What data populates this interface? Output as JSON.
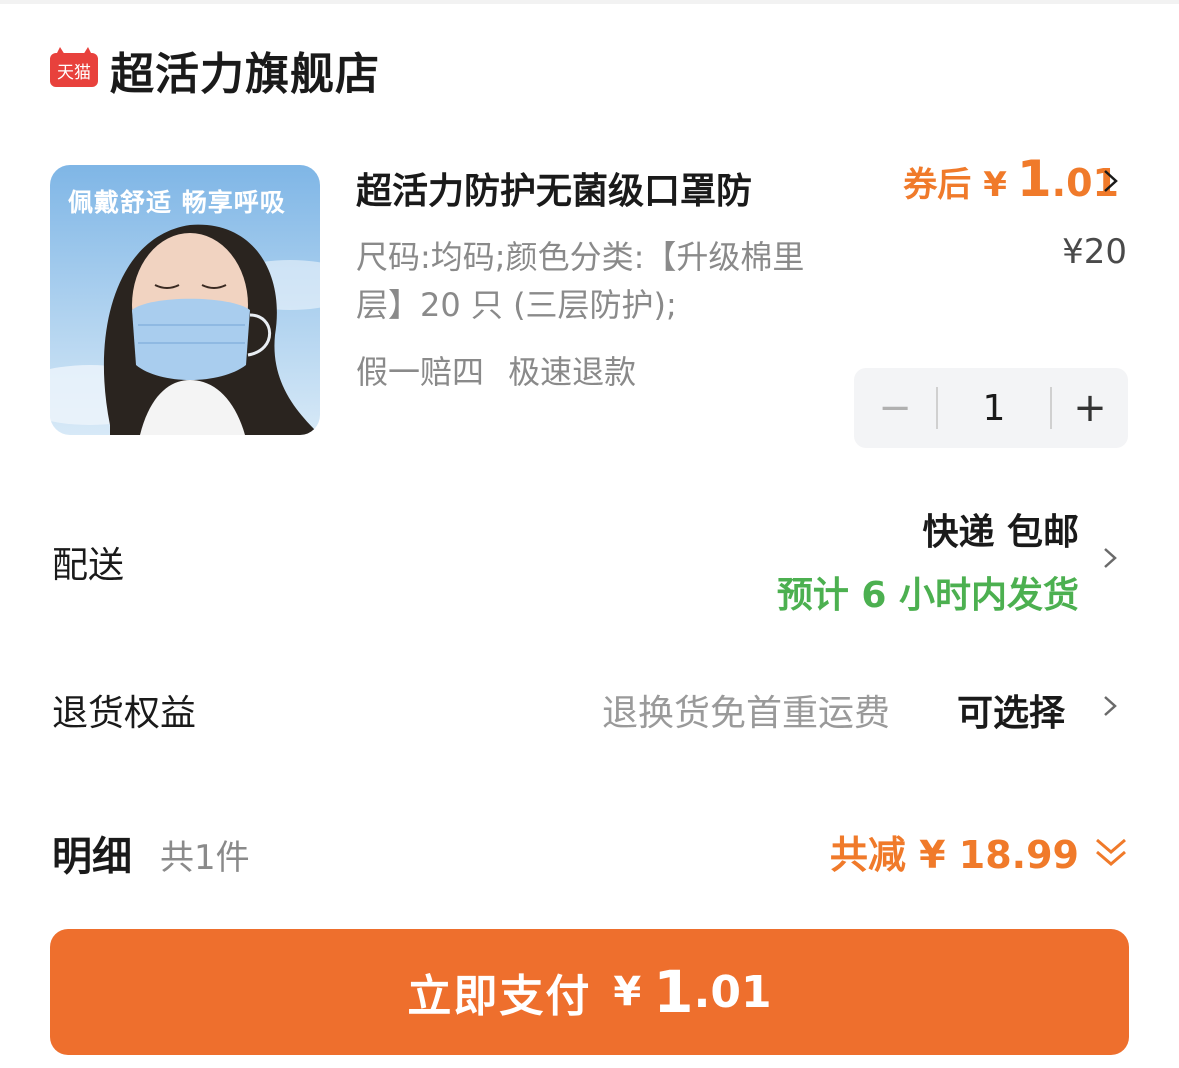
{
  "store": {
    "badge_text": "天猫",
    "name": "超活力旗舰店"
  },
  "product": {
    "image_caption": "佩戴舒适 畅享呼吸",
    "title": "超活力防护无菌级口罩防",
    "spec": "尺码:均码;颜色分类:【升级棉里层】20 只 (三层防护);",
    "guarantee": "假一赔四 极速退款",
    "price_label": "券后",
    "currency": "¥",
    "price_int": "1",
    "price_dec": ".01",
    "original_price": "¥20",
    "quantity": "1"
  },
  "delivery": {
    "label": "配送",
    "method": "快递 包邮",
    "estimate": "预计 6 小时内发货"
  },
  "returns": {
    "label": "退货权益",
    "description": "退换货免首重运费",
    "value": "可选择"
  },
  "detail": {
    "title": "明细",
    "count": "共1件",
    "discount": "共减 ¥ 18.99"
  },
  "pay_button": {
    "label": "立即支付",
    "currency": "¥",
    "amount_int": "1",
    "amount_dec": ".01"
  },
  "colors": {
    "accent_orange": "#ee6f2d",
    "price_orange": "#f07a2a",
    "green": "#4cb050",
    "tmall_red": "#e8413c"
  },
  "icons": [
    "tmall-badge-icon",
    "chevron-right-icon",
    "minus-icon",
    "plus-icon",
    "double-chevron-down-icon"
  ]
}
